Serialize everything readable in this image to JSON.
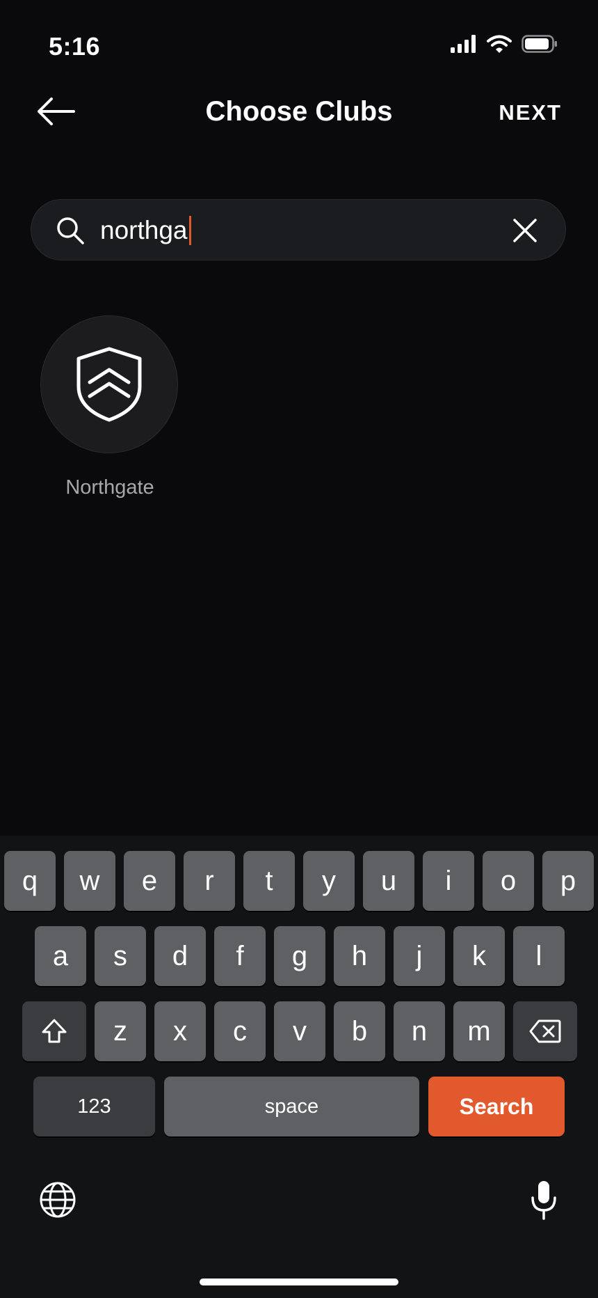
{
  "status": {
    "time": "5:16"
  },
  "nav": {
    "title": "Choose Clubs",
    "next_label": "NEXT"
  },
  "search": {
    "value": "northga"
  },
  "results": [
    {
      "name": "Northgate"
    }
  ],
  "keyboard": {
    "row1": [
      "q",
      "w",
      "e",
      "r",
      "t",
      "y",
      "u",
      "i",
      "o",
      "p"
    ],
    "row2": [
      "a",
      "s",
      "d",
      "f",
      "g",
      "h",
      "j",
      "k",
      "l"
    ],
    "row3": [
      "z",
      "x",
      "c",
      "v",
      "b",
      "n",
      "m"
    ],
    "numbers_label": "123",
    "space_label": "space",
    "search_label": "Search"
  },
  "colors": {
    "accent": "#e3592e",
    "background": "#0a0a0c"
  }
}
